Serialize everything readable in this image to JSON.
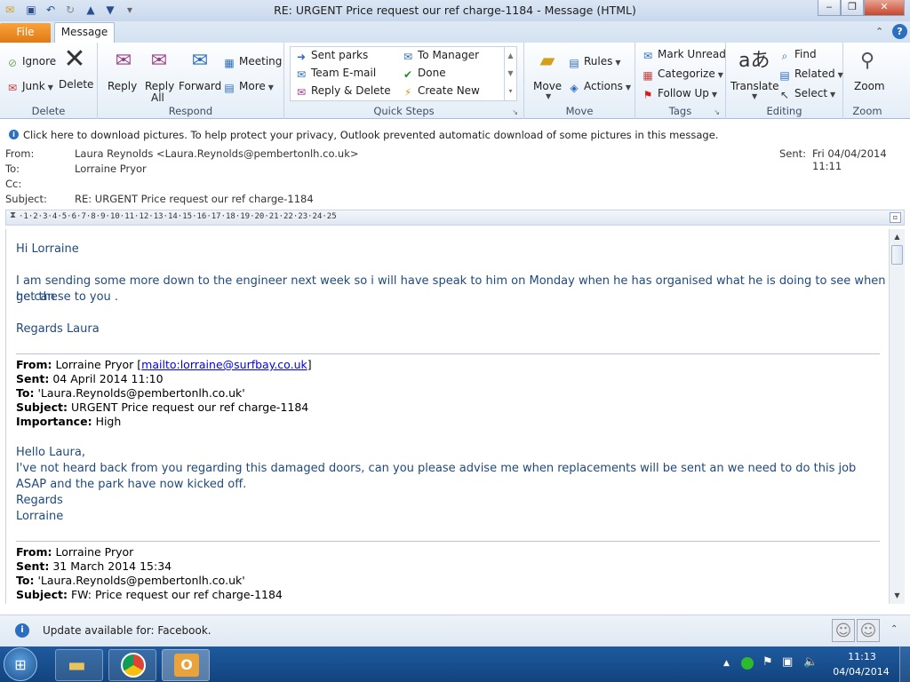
{
  "window": {
    "title": "RE: URGENT Price request our ref charge-1184  -  Message (HTML)"
  },
  "tabs": {
    "file": "File",
    "message": "Message"
  },
  "ribbon": {
    "delete_group": {
      "label": "Delete",
      "ignore": "Ignore",
      "junk": "Junk",
      "delete": "Delete"
    },
    "respond_group": {
      "label": "Respond",
      "reply": "Reply",
      "reply_all_1": "Reply",
      "reply_all_2": "All",
      "forward": "Forward",
      "meeting": "Meeting",
      "more": "More"
    },
    "quick_steps": {
      "label": "Quick Steps",
      "items": [
        "Sent parks",
        "To Manager",
        "Team E-mail",
        "Done",
        "Reply & Delete",
        "Create New"
      ]
    },
    "move_group": {
      "label": "Move",
      "move": "Move",
      "rules": "Rules",
      "actions": "Actions"
    },
    "tags_group": {
      "label": "Tags",
      "mark_unread": "Mark Unread",
      "categorize": "Categorize",
      "follow_up": "Follow Up"
    },
    "editing_group": {
      "label": "Editing",
      "translate": "Translate",
      "find": "Find",
      "related": "Related",
      "select": "Select"
    },
    "zoom_group": {
      "label": "Zoom",
      "zoom": "Zoom"
    }
  },
  "infobar": {
    "text": "Click here to download pictures. To help protect your privacy, Outlook prevented automatic download of some pictures in this message."
  },
  "header": {
    "from_label": "From:",
    "from_value": "Laura Reynolds <Laura.Reynolds@pembertonlh.co.uk>",
    "to_label": "To:",
    "to_value": "Lorraine Pryor",
    "cc_label": "Cc:",
    "subject_label": "Subject:",
    "subject_value": "RE: URGENT Price request our ref charge-1184",
    "sent_label": "Sent:",
    "sent_value": "Fri 04/04/2014 11:11"
  },
  "ruler": {
    "ticks": "·1·2·3·4·5·6·7·8·9·10·11·12·13·14·15·16·17·18·19·20·21·22·23·24·25"
  },
  "body": {
    "greeting": "Hi Lorraine",
    "para1_line1": "I am sending some more down to the engineer next week so i will have speak to him on Monday when he has organised what he is doing to see when he can",
    "para1_line2": "get these to you .",
    "signoff": "Regards Laura",
    "quote1": {
      "from_label": "From:",
      "from_value": "Lorraine Pryor [",
      "from_link": "mailto:lorraine@surfbay.co.uk",
      "from_close": "]",
      "sent_label": "Sent:",
      "sent_value": "04 April 2014 11:10",
      "to_label": "To:",
      "to_value": "'Laura.Reynolds@pembertonlh.co.uk'",
      "subject_label": "Subject:",
      "subject_value": "URGENT Price request our ref charge-1184",
      "importance_label": "Importance:",
      "importance_value": "High",
      "greeting": "Hello Laura,",
      "line1": "I've not heard back from you regarding this damaged doors, can you please advise me when replacements will be sent an we need to do this job",
      "line2": "ASAP and the park have now kicked off.",
      "regards": "Regards",
      "name": "Lorraine"
    },
    "quote2": {
      "from_label": "From:",
      "from_value": "Lorraine Pryor",
      "sent_label": "Sent:",
      "sent_value": "31 March 2014 15:34",
      "to_label": "To:",
      "to_value": "'Laura.Reynolds@pembertonlh.co.uk'",
      "subject_label": "Subject:",
      "subject_value": "FW: Price request our ref charge-1184"
    }
  },
  "statusbar": {
    "text": "Update available for: Facebook."
  },
  "taskbar": {
    "time": "11:13",
    "date": "04/04/2014"
  }
}
